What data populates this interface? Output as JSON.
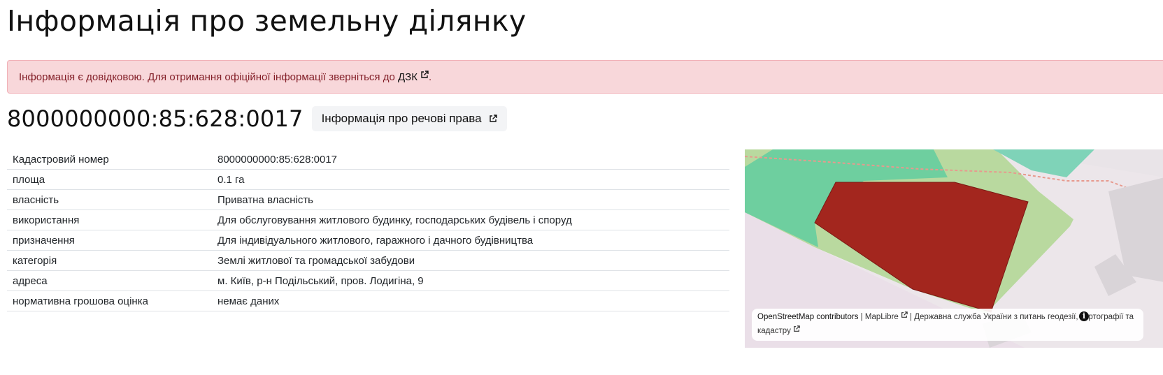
{
  "page": {
    "title": "Інформація про земельну ділянку"
  },
  "alert": {
    "text": "Інформація є довідковою. Для отримання офіційної інформації зверніться до ",
    "link_label": "ДЗК",
    "suffix": "."
  },
  "parcel": {
    "cadastral_number": "8000000000:85:628:0017",
    "rights_button_label": "Інформація про речові права"
  },
  "details": [
    {
      "key": "Кадастровий номер",
      "value": "8000000000:85:628:0017"
    },
    {
      "key": "площа",
      "value": "0.1 га"
    },
    {
      "key": "власність",
      "value": "Приватна власність"
    },
    {
      "key": "використання",
      "value": "Для обслуговування житлового будинку, господарських будівель і споруд"
    },
    {
      "key": "призначення",
      "value": "Для індивідуального житлового, гаражного і дачного будівництва"
    },
    {
      "key": "категорія",
      "value": "Землі житлової та громадської забудови"
    },
    {
      "key": "адреса",
      "value": "м. Київ, р-н Подільський, пров. Лодигіна, 9"
    },
    {
      "key": "нормативна грошова оцінка",
      "value": "немає даних"
    }
  ],
  "map": {
    "attribution_osm": "OpenStreetMap contributors",
    "attribution_sep1": " | ",
    "attribution_maplibre": "MapLibre",
    "attribution_sep2": " | ",
    "attribution_dzk": "Державна служба України з питань геодезії, картографії та кадастру",
    "info_icon_glyph": "i",
    "colors": {
      "parcel_fill": "#a3261e",
      "green_area": "#6ecf9f",
      "light_green": "#b9d99f",
      "background": "#e9e4e8"
    }
  }
}
